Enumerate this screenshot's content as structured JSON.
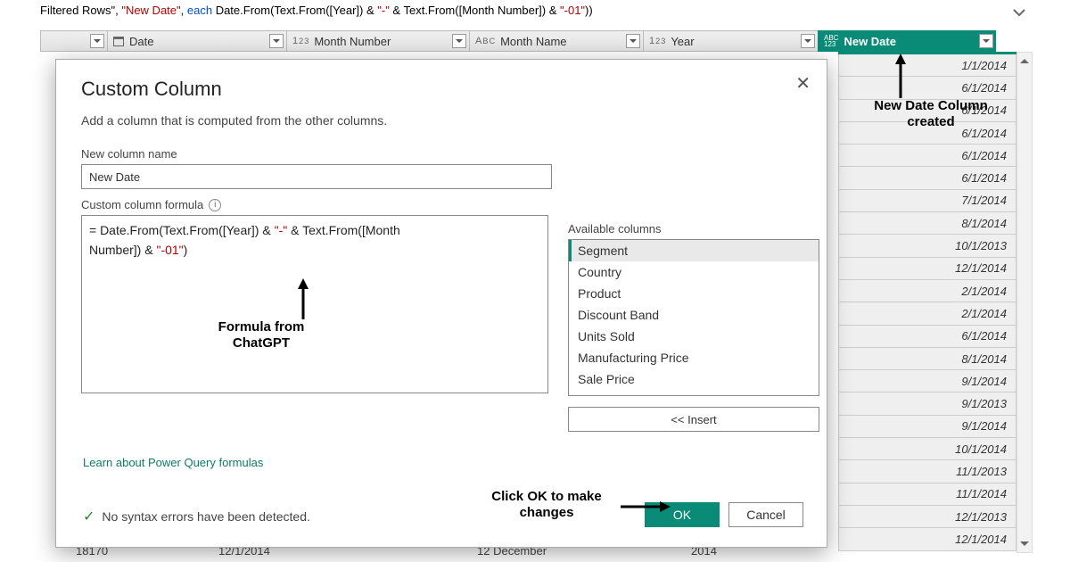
{
  "formula_bar": {
    "p0": "Filtered Rows\"",
    "p1": ", ",
    "p2": "\"New Date\"",
    "p3": ", ",
    "p4": "each",
    "p5": " Date.From(Text.From([Year]) & ",
    "p6": "\"-\"",
    "p7": " & Text.From([Month Number]) & ",
    "p8": "\"-01\"",
    "p9": "))"
  },
  "columns": {
    "row_selector": "",
    "date": "Date",
    "month_number": "Month Number",
    "month_name": "Month Name",
    "year": "Year",
    "new_date": "New Date",
    "type_num": "1²₃",
    "type_abc": "Aᴮᴄ",
    "type_any": "ABC\n123",
    "type_date_icon": "📅"
  },
  "new_date_values": [
    "1/1/2014",
    "6/1/2014",
    "6/1/2014",
    "6/1/2014",
    "6/1/2014",
    "6/1/2014",
    "7/1/2014",
    "8/1/2014",
    "10/1/2013",
    "12/1/2014",
    "2/1/2014",
    "2/1/2014",
    "6/1/2014",
    "8/1/2014",
    "9/1/2014",
    "9/1/2013",
    "9/1/2014",
    "10/1/2014",
    "11/1/2013",
    "11/1/2014",
    "12/1/2013",
    "12/1/2014"
  ],
  "bottom_row": {
    "a": "18170",
    "b": "12/1/2014",
    "c": "12  December",
    "d": "2014"
  },
  "dialog": {
    "title": "Custom Column",
    "subtitle": "Add a column that is computed from the other columns.",
    "new_col_label": "New column name",
    "new_col_value": "New Date",
    "formula_label": "Custom column formula",
    "formula_p0": "= Date.From(Text.From([Year]) & ",
    "formula_p1": "\"-\"",
    "formula_p2": " & Text.From([Month",
    "formula_p3": "    Number]) & ",
    "formula_p4": "\"-01\"",
    "formula_p5": ")",
    "available_label": "Available columns",
    "available_columns": [
      "Segment",
      "Country",
      "Product",
      "Discount Band",
      "Units Sold",
      "Manufacturing Price",
      "Sale Price"
    ],
    "insert": "<< Insert",
    "learn_link": "Learn about Power Query formulas",
    "status": "No syntax errors have been detected.",
    "ok": "OK",
    "cancel": "Cancel"
  },
  "annotations": {
    "new_col_created": "New Date Column created",
    "formula_from": "Formula from ChatGPT",
    "click_ok": "Click OK to make changes"
  }
}
